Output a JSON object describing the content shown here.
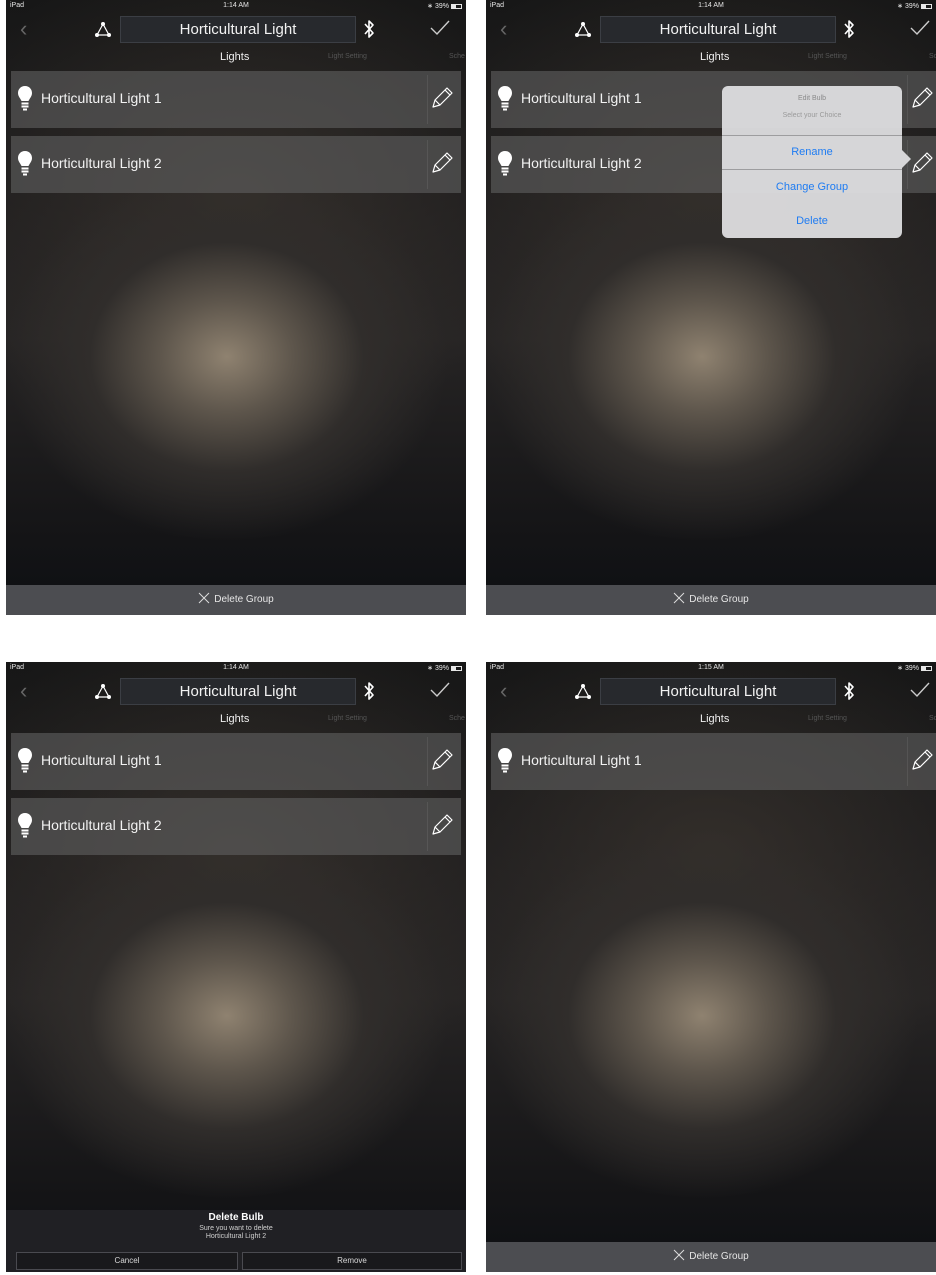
{
  "status": {
    "carrier": "iPad",
    "battery": "39%",
    "time_1": "1:14 AM",
    "time_2": "1:15 AM"
  },
  "nav": {
    "back_icon": "chevron-left-icon",
    "group_icon": "group-nodes-icon",
    "title": "Horticultural Light",
    "bluetooth_icon": "bluetooth-icon",
    "confirm_icon": "checkmark-icon"
  },
  "tabs": {
    "lights": "Lights",
    "setting": "Light Setting",
    "schedule_1": "Sche",
    "schedule_2": "Sc",
    "schedule_4": "Sc"
  },
  "lights": [
    {
      "label": "Horticultural Light 1",
      "icon": "bulb-icon",
      "edit_icon": "pencil-icon"
    },
    {
      "label": "Horticultural Light 2",
      "icon": "bulb-icon",
      "edit_icon": "pencil-icon"
    }
  ],
  "bottom": {
    "delete_group": "Delete Group"
  },
  "popover": {
    "title": "Edit Bulb",
    "subtitle": "Select your Choice",
    "rename": "Rename",
    "change_group": "Change Group",
    "delete": "Delete",
    "accent": "#1f7cf2"
  },
  "action_sheet": {
    "title": "Delete Bulb",
    "message_line1": "Sure you want to delete",
    "message_line2": "Horticultural Light 2",
    "cancel": "Cancel",
    "remove": "Remove"
  }
}
